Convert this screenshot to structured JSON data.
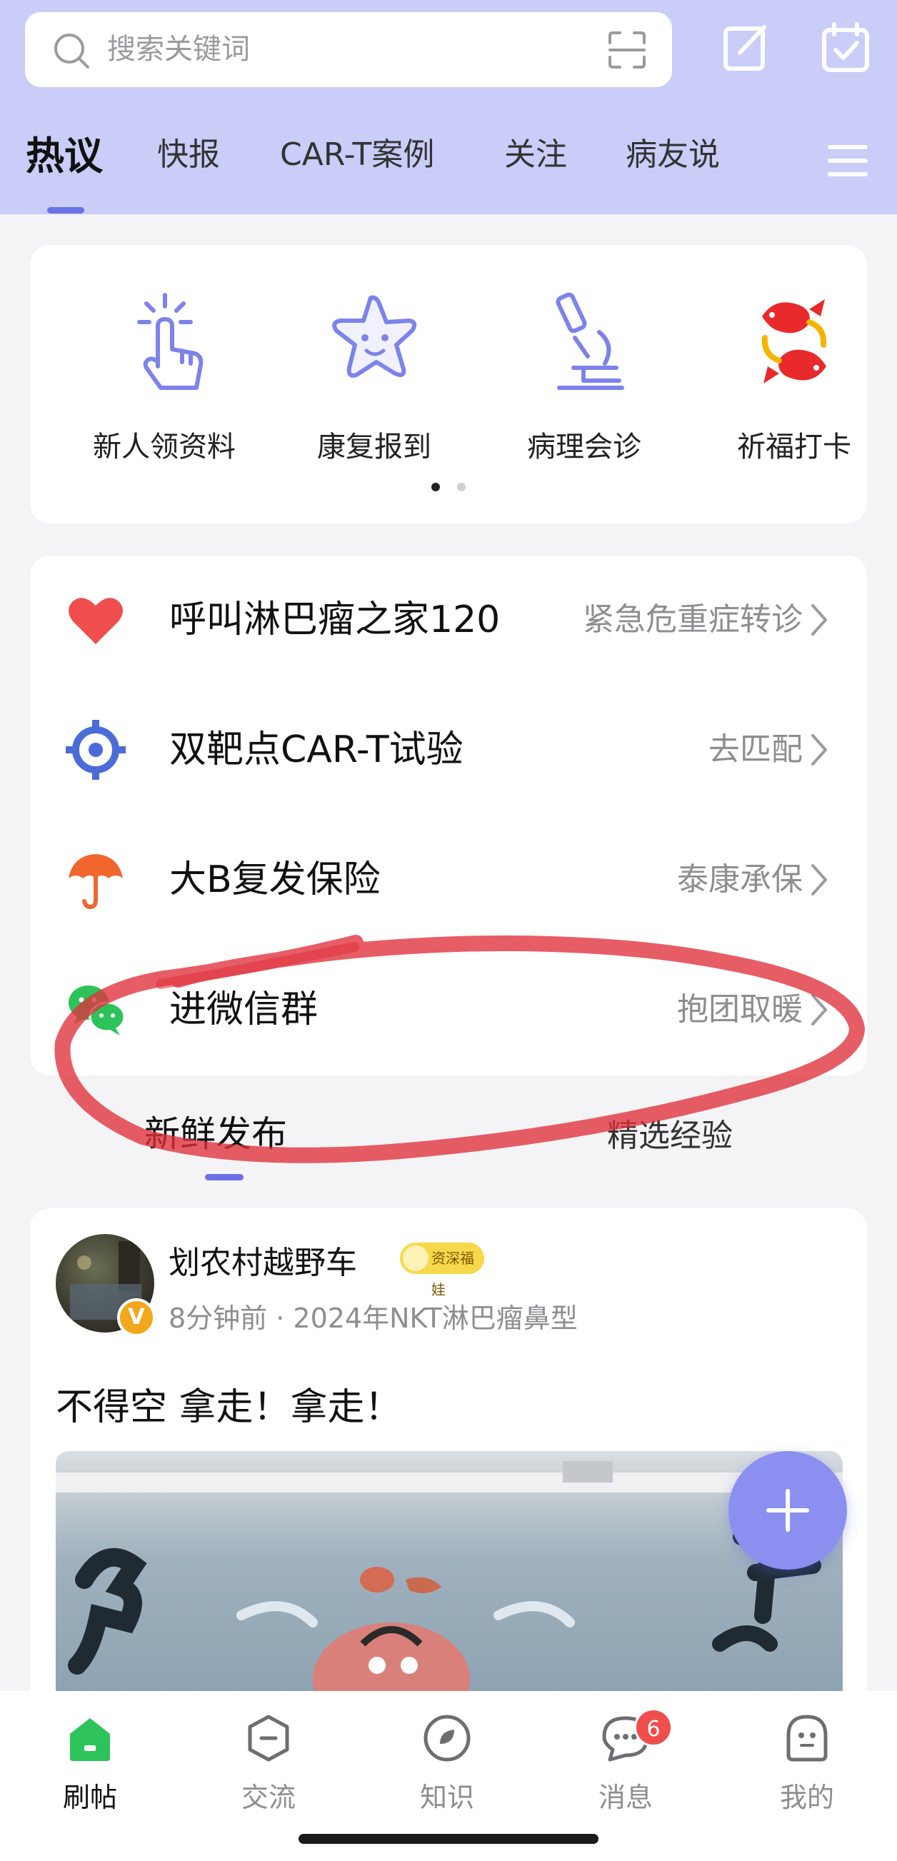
{
  "search": {
    "placeholder": "搜索关键词"
  },
  "tabs": [
    {
      "label": "热议",
      "active": true
    },
    {
      "label": "快报"
    },
    {
      "label": "CAR-T案例"
    },
    {
      "label": "关注"
    },
    {
      "label": "病友说"
    }
  ],
  "quick_entries": [
    {
      "label": "新人领资料",
      "icon": "tap-hand-icon"
    },
    {
      "label": "康复报到",
      "icon": "star-face-icon"
    },
    {
      "label": "病理会诊",
      "icon": "microscope-icon"
    },
    {
      "label": "祈福打卡",
      "icon": "koi-fish-icon"
    }
  ],
  "services": [
    {
      "title": "呼叫淋巴瘤之家120",
      "hint": "紧急危重症转诊",
      "icon": "heart-icon",
      "color": "#f04d4d"
    },
    {
      "title": "双靶点CAR-T试验",
      "hint": "去匹配",
      "icon": "target-icon",
      "color": "#4b6bd9"
    },
    {
      "title": "大B复发保险",
      "hint": "泰康承保",
      "icon": "umbrella-icon",
      "color": "#f0662c"
    },
    {
      "title": "进微信群",
      "hint": "抱团取暖",
      "icon": "wechat-icon",
      "color": "#2dc35a"
    }
  ],
  "feed_tabs": {
    "fresh": "新鲜发布",
    "selected": "精选经验"
  },
  "post": {
    "author": "划农村越野车",
    "badge": "资深福娃",
    "verified": "V",
    "meta": "8分钟前 · 2024年NKT淋巴瘤鼻型",
    "text": "不得空 拿走！拿走！"
  },
  "bottom_nav": [
    {
      "label": "刷帖",
      "icon": "home-icon",
      "active": true
    },
    {
      "label": "交流",
      "icon": "hexagon-chat-icon"
    },
    {
      "label": "知识",
      "icon": "knowledge-icon"
    },
    {
      "label": "消息",
      "icon": "message-icon",
      "badge": "6"
    },
    {
      "label": "我的",
      "icon": "profile-icon"
    }
  ],
  "colors": {
    "accent": "#6b72e8",
    "header_bg": "#c9cdf7",
    "home_green": "#2dc35a",
    "annotation": "#e0303a"
  }
}
